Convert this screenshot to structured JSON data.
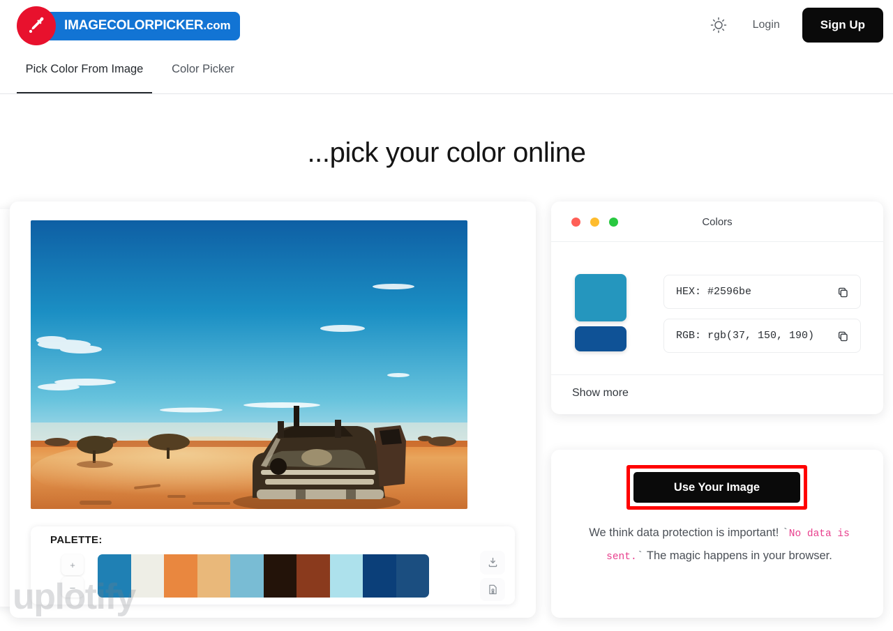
{
  "header": {
    "logo_text": "IMAGECOLORPICKER",
    "logo_suffix": ".com",
    "theme_icon": "sun-icon",
    "login_label": "Login",
    "signup_label": "Sign Up"
  },
  "tabs": [
    {
      "label": "Pick Color From Image",
      "active": true
    },
    {
      "label": "Color Picker",
      "active": false
    }
  ],
  "hero": {
    "title": "...pick your color online"
  },
  "palette": {
    "label": "PALETTE:",
    "zoom_in_label": "+",
    "zoom_out_label": "–",
    "download_icon": "download-icon",
    "save_icon": "save-file-icon",
    "swatches": [
      "#1f80b4",
      "#eeeee6",
      "#e9873f",
      "#e9b87a",
      "#79bcd4",
      "#231309",
      "#8a3a1d",
      "#ade1ec",
      "#0b3f79",
      "#1b4e80"
    ]
  },
  "watermark": "uplotify",
  "colors_panel": {
    "title": "Colors",
    "window_dots": [
      "#ff5f57",
      "#febc2e",
      "#28c840"
    ],
    "selected_swatch": "#2596be",
    "secondary_swatch": "#0f5296",
    "hex_label": "HEX:",
    "hex_value": "#2596be",
    "hex_text": "HEX: #2596be",
    "rgb_label": "RGB:",
    "rgb_value": "rgb(37, 150, 190)",
    "rgb_text": "RGB: rgb(37, 150, 190)",
    "copy_icon": "copy-icon",
    "show_more_label": "Show more"
  },
  "use_panel": {
    "button_label": "Use Your Image",
    "highlight_color": "#ff0000",
    "note_part1": "We think data protection is important! ",
    "note_code": "No data is sent.",
    "note_part2": " The magic happens in your browser."
  }
}
